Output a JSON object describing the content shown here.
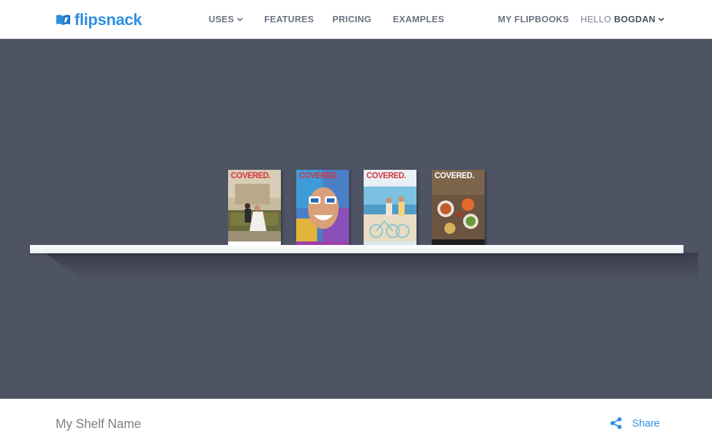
{
  "brand": {
    "name": "flipsnack",
    "color": "#2f8fe0"
  },
  "nav": {
    "uses": "USES",
    "features": "FEATURES",
    "pricing": "PRICING",
    "examples": "EXAMPLES",
    "my_flipbooks": "MY FLIPBOOKS",
    "hello": "HELLO",
    "user": "BOGDAN"
  },
  "shelf": {
    "background": "#4f5465",
    "books": [
      {
        "title": "COVERED.",
        "title_color": "#d6343c"
      },
      {
        "title": "COVERED.",
        "title_color": "#d6343c"
      },
      {
        "title": "COVERED.",
        "title_color": "#d6343c"
      },
      {
        "title": "COVERED.",
        "title_color": "#ffffff"
      }
    ]
  },
  "footer": {
    "shelf_name": "My Shelf Name",
    "share_label": "Share"
  },
  "icons": [
    "flipsnack-logo-icon",
    "chevron-down-icon",
    "share-icon"
  ]
}
